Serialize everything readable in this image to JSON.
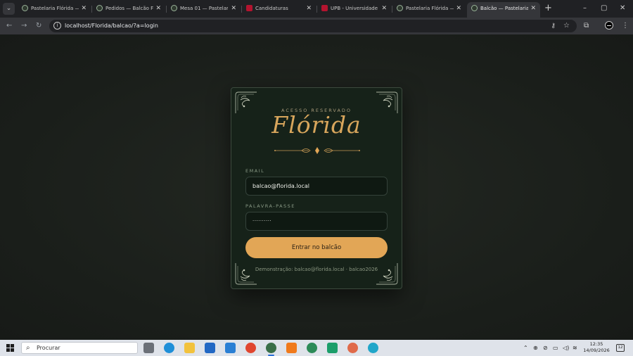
{
  "browser": {
    "tabs": [
      {
        "title": "Pastelaria Flórida — ",
        "icon": "flower-favicon",
        "active": false
      },
      {
        "title": "Pedidos — Balcão Flo",
        "icon": "flower-favicon",
        "active": false
      },
      {
        "title": "Mesa 01 — Pastelaria",
        "icon": "flower-favicon",
        "active": false
      },
      {
        "title": "Candidaturas",
        "icon": "upb-favicon",
        "active": false
      },
      {
        "title": "UPB - Universidade P",
        "icon": "upb-favicon",
        "active": false
      },
      {
        "title": "Pastelaria Flórida — ",
        "icon": "flower-favicon",
        "active": false
      },
      {
        "title": "Balcão — Pastelaria F",
        "icon": "flower-favicon",
        "active": true
      }
    ],
    "url": "localhost/Florida/balcao/?a=login",
    "new_tab_symbol": "+",
    "window_controls": [
      "–",
      "▢",
      "✕"
    ]
  },
  "login": {
    "eyebrow": "ACESSO RESERVADO",
    "brand": "Flórida",
    "email_label": "EMAIL",
    "email_value": "balcao@florida.local",
    "password_label": "PALAVRA-PASSE",
    "password_value": "··········",
    "submit_label": "Entrar no balcão",
    "demo_text": "Demonstração: balcao@florida.local · balcao2026"
  },
  "taskbar": {
    "search_placeholder": "Procurar",
    "time": "12:35",
    "date": "14/09/2026",
    "notification_count": "12"
  },
  "colors": {
    "page_bg": "#1c201c",
    "card_bg": "#162219",
    "accent_gold": "#e2a656",
    "brand_gold": "#d8a65c"
  }
}
